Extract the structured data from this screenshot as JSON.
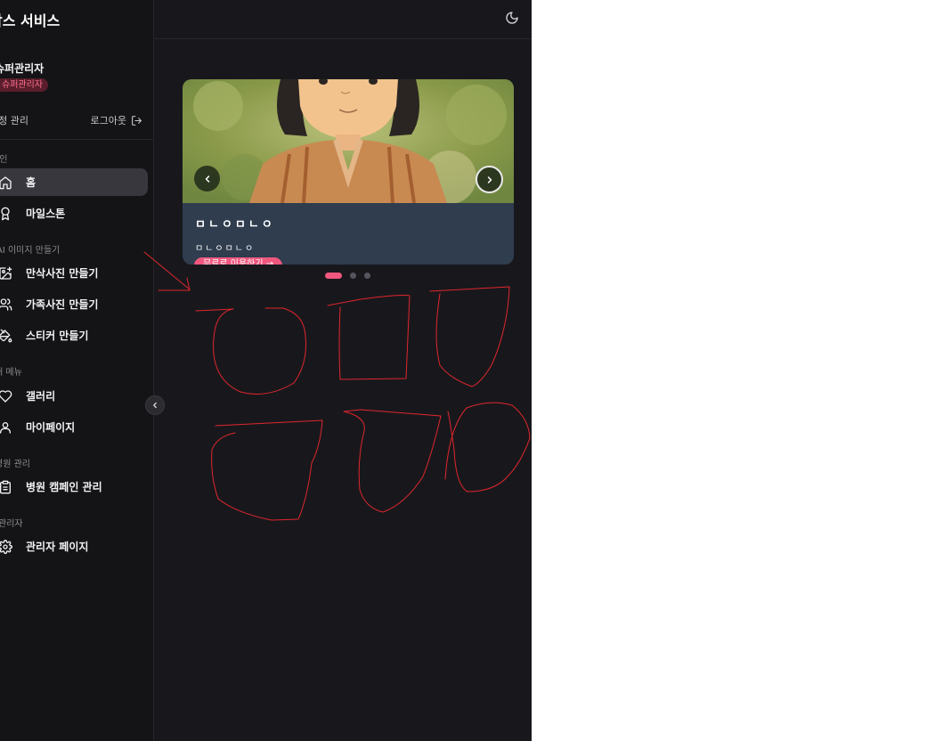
{
  "app": {
    "title": "맘스 서비스"
  },
  "user": {
    "name": "슈퍼관리자",
    "role_badge": "슈퍼관리자"
  },
  "account": {
    "manage_label": "계정 관리",
    "logout_label": "로그아웃"
  },
  "sidebar": {
    "sections": [
      {
        "label": "메인",
        "items": [
          {
            "label": "홈",
            "icon": "home-icon",
            "active": true
          },
          {
            "label": "마일스톤",
            "icon": "award-icon"
          }
        ]
      },
      {
        "label": "AI 이미지 만들기",
        "items": [
          {
            "label": "만삭사진 만들기",
            "icon": "image-plus-icon"
          },
          {
            "label": "가족사진 만들기",
            "icon": "users-icon"
          },
          {
            "label": "스티커 만들기",
            "icon": "sticker-icon"
          }
        ]
      },
      {
        "label": "내 메뉴",
        "items": [
          {
            "label": "갤러리",
            "icon": "heart-icon"
          },
          {
            "label": "마이페이지",
            "icon": "user-icon"
          }
        ]
      },
      {
        "label": "병원 관리",
        "items": [
          {
            "label": "병원 캠페인 관리",
            "icon": "clipboard-icon"
          }
        ]
      },
      {
        "label": "관리자",
        "items": [
          {
            "label": "관리자 페이지",
            "icon": "gear-icon"
          }
        ]
      }
    ]
  },
  "carousel": {
    "slide": {
      "title": "ㅁㄴㅇㅁㄴㅇ",
      "subtitle": "ㅁㄴㅇㅁㄴㅇ",
      "cta_label": "무료로 이용하기 →"
    },
    "dots": {
      "count": 3,
      "active_index": 0
    }
  },
  "colors": {
    "accent": "#f0577e",
    "sidebar_bg": "#141416",
    "main_bg": "#18181c",
    "annotation_red": "#e0262d"
  }
}
